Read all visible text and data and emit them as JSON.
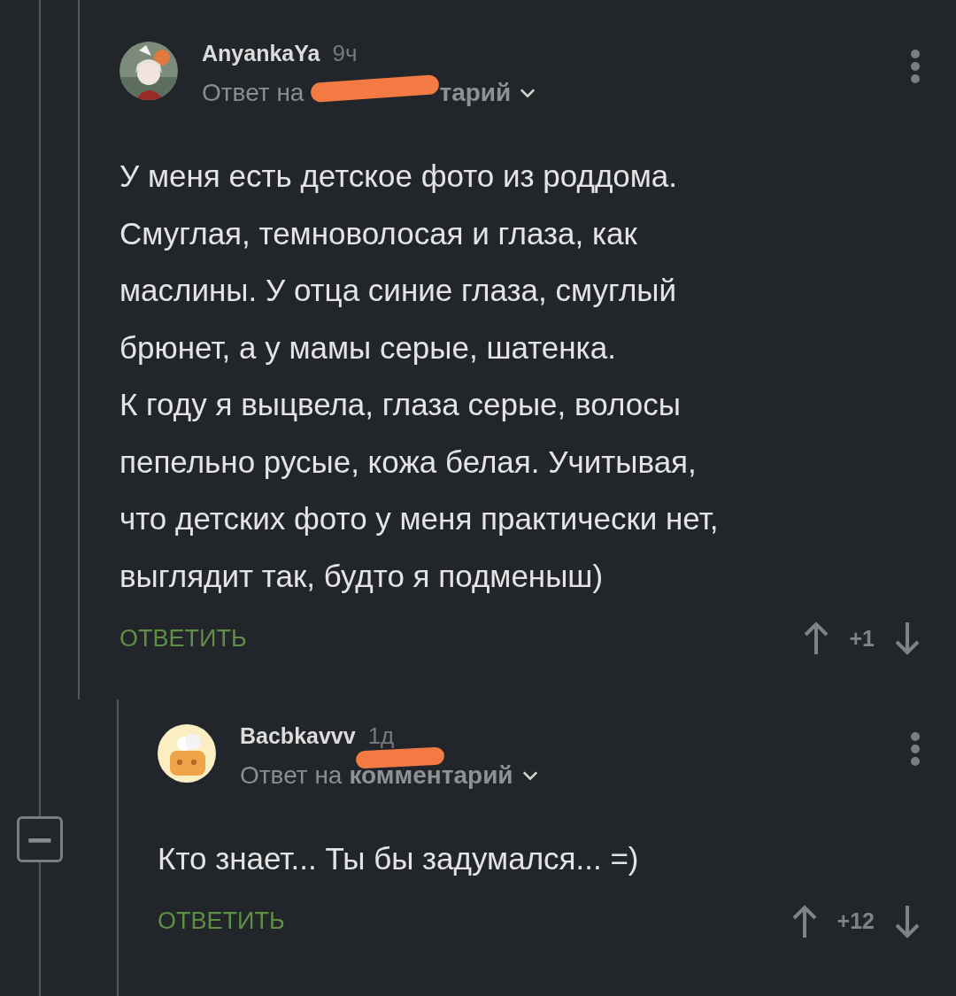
{
  "thread": {
    "collapse_button": "−",
    "comments": [
      {
        "author": "AnyankaYa",
        "time": "9ч",
        "reply_to": {
          "prefix": "Ответ на",
          "target": "тарий"
        },
        "text": "У меня есть детское фото из роддома.\nСмуглая, темноволосая и глаза, как\nмаслины. У отца синие глаза, смуглый\nбрюнет, а у мамы серые, шатенка.\nК году я выцвела, глаза серые, волосы\nпепельно русые, кожа белая. Учитывая,\nчто детских фото у меня практически нет,\nвыглядит так, будто я подменыш)",
        "reply_button": "ОТВЕТИТЬ",
        "rating": "+1",
        "children": [
          {
            "author": "Bacbkavvv",
            "time": "1д",
            "reply_to": {
              "prefix": "Ответ на",
              "target": "комментарий"
            },
            "text": "Кто знает... Ты бы задумался... =)",
            "reply_button": "ОТВЕТИТЬ",
            "rating": "+12"
          }
        ]
      }
    ]
  }
}
